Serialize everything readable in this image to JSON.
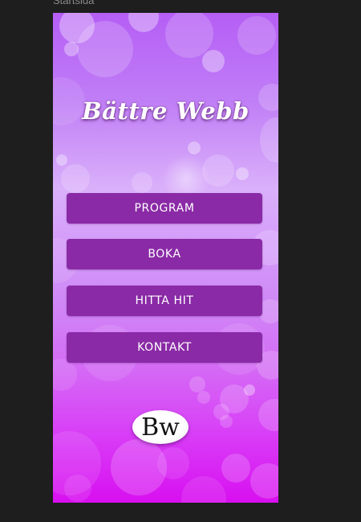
{
  "frame": {
    "label": "Startsida"
  },
  "app": {
    "title": "Bättre Webb",
    "colors": {
      "button_bg": "#8a2aa6",
      "background_top": "#b55ef5",
      "background_bottom": "#d80ff0"
    }
  },
  "menu": {
    "items": [
      {
        "label": "PROGRAM"
      },
      {
        "label": "BOKA"
      },
      {
        "label": "HITTA HIT"
      },
      {
        "label": "KONTAKT"
      }
    ]
  },
  "logo": {
    "text": "Bw"
  }
}
